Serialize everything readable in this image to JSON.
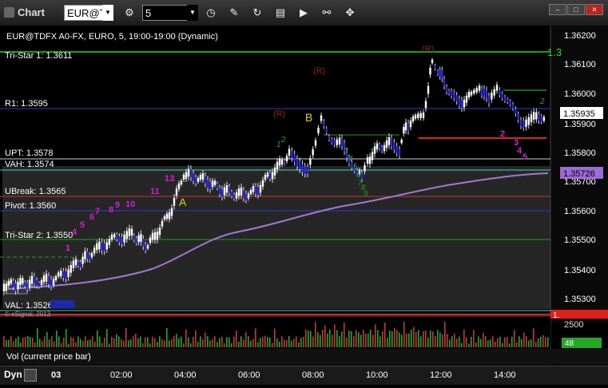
{
  "window": {
    "title": "Chart"
  },
  "toolbar": {
    "symbol": "EUR@TD",
    "interval": "5",
    "buttons": [
      "clock-icon",
      "pencil-icon",
      "refresh-icon",
      "news-icon",
      "play-icon",
      "link-icon"
    ]
  },
  "chart": {
    "header": "EUR@TDFX A0-FX, EURO, 5, 19:00-19:00 (Dynamic)",
    "copyright": "© eSignal, 2013",
    "price_axis": [
      "1.36200",
      "1.36100",
      "1.36000",
      "1.35900",
      "1.35800",
      "1.35700",
      "1.35600",
      "1.35500",
      "1.35400",
      "1.35300"
    ],
    "last_price": "1.35935",
    "vwap_price": "1.35726",
    "bottom_price_marker": "1.",
    "volume_axis": "2500",
    "volume_value": "48",
    "volume_label": "Vol (current price bar)",
    "time_axis": [
      "03",
      "02:00",
      "04:00",
      "06:00",
      "08:00",
      "10:00",
      "12:00",
      "14:00"
    ],
    "levels": [
      {
        "label": "Tri-Star 1: 1.3611",
        "color": "#19d919"
      },
      {
        "label": "R1: 1.3595",
        "color": "#2a3fc9"
      },
      {
        "label": "UPT: 1.3578",
        "color": "#cfcfcf"
      },
      {
        "label": "VAH: 1.3574",
        "color": "#3fd6c8"
      },
      {
        "label": "UBreak: 1.3565",
        "color": "#c0392b"
      },
      {
        "label": "Pivot: 1.3560",
        "color": "#2a3fc9"
      },
      {
        "label": "Tri-Star 2: 1.3550",
        "color": "#19a019"
      },
      {
        "label": "VAL: 1.3526",
        "color": "#3fd6c8"
      }
    ],
    "tristar_right_label": "1.3",
    "annotations": {
      "A": "A",
      "B": "B",
      "R": "(R)",
      "seq_magenta": [
        "1",
        "4",
        "5",
        "6",
        "7",
        "8",
        "9",
        "10",
        "11",
        "13"
      ],
      "seq_right_magenta": [
        "2",
        "3",
        "4",
        "5"
      ],
      "seq_green": [
        "1",
        "2",
        "3",
        "4",
        "5",
        "6",
        "7",
        "8",
        "9"
      ]
    }
  },
  "statusbar": {
    "mode": "Dyn"
  }
}
